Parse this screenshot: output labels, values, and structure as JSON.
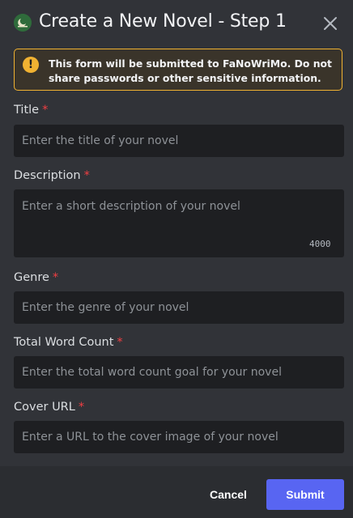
{
  "modal": {
    "title": "Create a New Novel - Step 1"
  },
  "warning": {
    "text_before": "This form will be submitted to ",
    "app_name": "FaNoWriMo",
    "text_after": ". Do not share passwords or other sensitive information.",
    "icon": "exclamation-circle-icon",
    "accent_color": "#f0b232"
  },
  "fields": {
    "title": {
      "label": "Title",
      "required": "*",
      "placeholder": "Enter the title of your novel",
      "value": ""
    },
    "description": {
      "label": "Description",
      "required": "*",
      "placeholder": "Enter a short description of your novel",
      "value": "",
      "char_limit": "4000"
    },
    "genre": {
      "label": "Genre",
      "required": "*",
      "placeholder": "Enter the genre of your novel",
      "value": ""
    },
    "word_count": {
      "label": "Total Word Count",
      "required": "*",
      "placeholder": "Enter the total word count goal for your novel",
      "value": ""
    },
    "cover_url": {
      "label": "Cover URL",
      "required": "*",
      "placeholder": "Enter a URL to the cover image of your novel",
      "value": ""
    }
  },
  "footer": {
    "cancel_label": "Cancel",
    "submit_label": "Submit",
    "submit_color": "#5865f2"
  }
}
